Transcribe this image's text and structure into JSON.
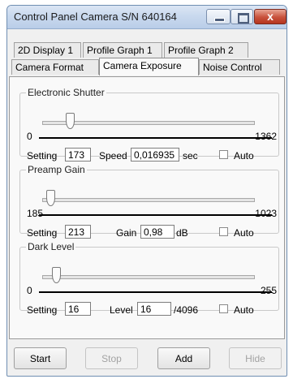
{
  "window": {
    "title": "Control Panel Camera S/N 640164",
    "close_glyph": "x"
  },
  "tabs": [
    {
      "label": "2D Display 1"
    },
    {
      "label": "Profile Graph 1"
    },
    {
      "label": "Profile Graph 2"
    },
    {
      "label": "Camera Format"
    },
    {
      "label": "Camera Exposure",
      "active": true
    },
    {
      "label": "Noise Control"
    }
  ],
  "groups": {
    "shutter": {
      "title": "Electronic Shutter",
      "min": "0",
      "max": "1362",
      "setting_label": "Setting",
      "setting_value": "173",
      "value_label": "Speed",
      "value": "0,016935",
      "unit": "sec",
      "auto_label": "Auto",
      "auto_checked": false,
      "level": 173
    },
    "gain": {
      "title": "Preamp Gain",
      "min": "185",
      "max": "1023",
      "setting_label": "Setting",
      "setting_value": "213",
      "value_label": "Gain",
      "value": "0,98",
      "unit": "dB",
      "auto_label": "Auto",
      "auto_checked": false,
      "level": 213
    },
    "dark": {
      "title": "Dark Level",
      "min": "0",
      "max": "255",
      "setting_label": "Setting",
      "setting_value": "16",
      "value_label": "Level",
      "value": "16",
      "unit": "/4096",
      "auto_label": "Auto",
      "auto_checked": false,
      "level": 16
    }
  },
  "buttons": {
    "start": {
      "label": "Start",
      "enabled": true
    },
    "stop": {
      "label": "Stop",
      "enabled": false
    },
    "add": {
      "label": "Add",
      "enabled": true
    },
    "hide": {
      "label": "Hide",
      "enabled": false
    }
  },
  "colors": {
    "titlebar": "#c9d9ee",
    "close_button": "#c8513b",
    "disabled_text": "#a3a3a3"
  }
}
